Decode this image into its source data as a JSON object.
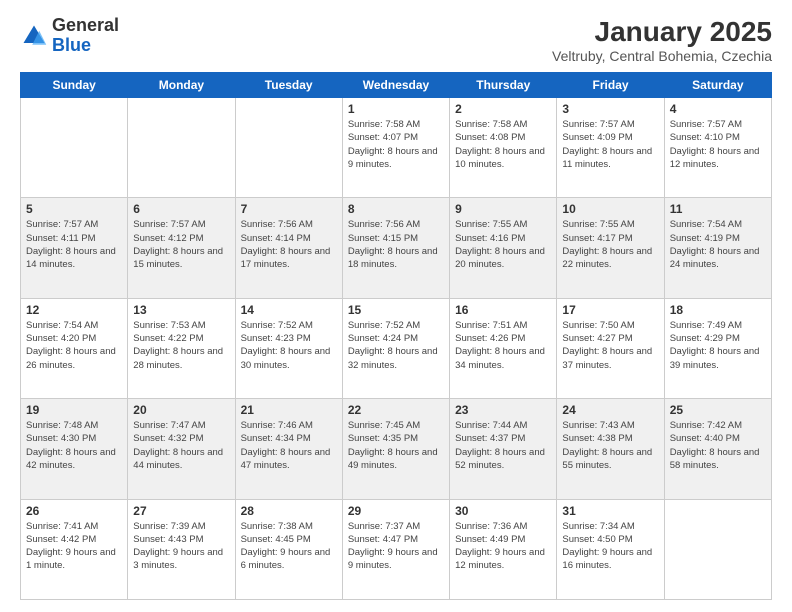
{
  "header": {
    "logo": {
      "general": "General",
      "blue": "Blue"
    },
    "title": "January 2025",
    "subtitle": "Veltruby, Central Bohemia, Czechia"
  },
  "weekdays": [
    "Sunday",
    "Monday",
    "Tuesday",
    "Wednesday",
    "Thursday",
    "Friday",
    "Saturday"
  ],
  "weeks": [
    [
      {
        "day": "",
        "sunrise": "",
        "sunset": "",
        "daylight": ""
      },
      {
        "day": "",
        "sunrise": "",
        "sunset": "",
        "daylight": ""
      },
      {
        "day": "",
        "sunrise": "",
        "sunset": "",
        "daylight": ""
      },
      {
        "day": "1",
        "sunrise": "Sunrise: 7:58 AM",
        "sunset": "Sunset: 4:07 PM",
        "daylight": "Daylight: 8 hours and 9 minutes."
      },
      {
        "day": "2",
        "sunrise": "Sunrise: 7:58 AM",
        "sunset": "Sunset: 4:08 PM",
        "daylight": "Daylight: 8 hours and 10 minutes."
      },
      {
        "day": "3",
        "sunrise": "Sunrise: 7:57 AM",
        "sunset": "Sunset: 4:09 PM",
        "daylight": "Daylight: 8 hours and 11 minutes."
      },
      {
        "day": "4",
        "sunrise": "Sunrise: 7:57 AM",
        "sunset": "Sunset: 4:10 PM",
        "daylight": "Daylight: 8 hours and 12 minutes."
      }
    ],
    [
      {
        "day": "5",
        "sunrise": "Sunrise: 7:57 AM",
        "sunset": "Sunset: 4:11 PM",
        "daylight": "Daylight: 8 hours and 14 minutes."
      },
      {
        "day": "6",
        "sunrise": "Sunrise: 7:57 AM",
        "sunset": "Sunset: 4:12 PM",
        "daylight": "Daylight: 8 hours and 15 minutes."
      },
      {
        "day": "7",
        "sunrise": "Sunrise: 7:56 AM",
        "sunset": "Sunset: 4:14 PM",
        "daylight": "Daylight: 8 hours and 17 minutes."
      },
      {
        "day": "8",
        "sunrise": "Sunrise: 7:56 AM",
        "sunset": "Sunset: 4:15 PM",
        "daylight": "Daylight: 8 hours and 18 minutes."
      },
      {
        "day": "9",
        "sunrise": "Sunrise: 7:55 AM",
        "sunset": "Sunset: 4:16 PM",
        "daylight": "Daylight: 8 hours and 20 minutes."
      },
      {
        "day": "10",
        "sunrise": "Sunrise: 7:55 AM",
        "sunset": "Sunset: 4:17 PM",
        "daylight": "Daylight: 8 hours and 22 minutes."
      },
      {
        "day": "11",
        "sunrise": "Sunrise: 7:54 AM",
        "sunset": "Sunset: 4:19 PM",
        "daylight": "Daylight: 8 hours and 24 minutes."
      }
    ],
    [
      {
        "day": "12",
        "sunrise": "Sunrise: 7:54 AM",
        "sunset": "Sunset: 4:20 PM",
        "daylight": "Daylight: 8 hours and 26 minutes."
      },
      {
        "day": "13",
        "sunrise": "Sunrise: 7:53 AM",
        "sunset": "Sunset: 4:22 PM",
        "daylight": "Daylight: 8 hours and 28 minutes."
      },
      {
        "day": "14",
        "sunrise": "Sunrise: 7:52 AM",
        "sunset": "Sunset: 4:23 PM",
        "daylight": "Daylight: 8 hours and 30 minutes."
      },
      {
        "day": "15",
        "sunrise": "Sunrise: 7:52 AM",
        "sunset": "Sunset: 4:24 PM",
        "daylight": "Daylight: 8 hours and 32 minutes."
      },
      {
        "day": "16",
        "sunrise": "Sunrise: 7:51 AM",
        "sunset": "Sunset: 4:26 PM",
        "daylight": "Daylight: 8 hours and 34 minutes."
      },
      {
        "day": "17",
        "sunrise": "Sunrise: 7:50 AM",
        "sunset": "Sunset: 4:27 PM",
        "daylight": "Daylight: 8 hours and 37 minutes."
      },
      {
        "day": "18",
        "sunrise": "Sunrise: 7:49 AM",
        "sunset": "Sunset: 4:29 PM",
        "daylight": "Daylight: 8 hours and 39 minutes."
      }
    ],
    [
      {
        "day": "19",
        "sunrise": "Sunrise: 7:48 AM",
        "sunset": "Sunset: 4:30 PM",
        "daylight": "Daylight: 8 hours and 42 minutes."
      },
      {
        "day": "20",
        "sunrise": "Sunrise: 7:47 AM",
        "sunset": "Sunset: 4:32 PM",
        "daylight": "Daylight: 8 hours and 44 minutes."
      },
      {
        "day": "21",
        "sunrise": "Sunrise: 7:46 AM",
        "sunset": "Sunset: 4:34 PM",
        "daylight": "Daylight: 8 hours and 47 minutes."
      },
      {
        "day": "22",
        "sunrise": "Sunrise: 7:45 AM",
        "sunset": "Sunset: 4:35 PM",
        "daylight": "Daylight: 8 hours and 49 minutes."
      },
      {
        "day": "23",
        "sunrise": "Sunrise: 7:44 AM",
        "sunset": "Sunset: 4:37 PM",
        "daylight": "Daylight: 8 hours and 52 minutes."
      },
      {
        "day": "24",
        "sunrise": "Sunrise: 7:43 AM",
        "sunset": "Sunset: 4:38 PM",
        "daylight": "Daylight: 8 hours and 55 minutes."
      },
      {
        "day": "25",
        "sunrise": "Sunrise: 7:42 AM",
        "sunset": "Sunset: 4:40 PM",
        "daylight": "Daylight: 8 hours and 58 minutes."
      }
    ],
    [
      {
        "day": "26",
        "sunrise": "Sunrise: 7:41 AM",
        "sunset": "Sunset: 4:42 PM",
        "daylight": "Daylight: 9 hours and 1 minute."
      },
      {
        "day": "27",
        "sunrise": "Sunrise: 7:39 AM",
        "sunset": "Sunset: 4:43 PM",
        "daylight": "Daylight: 9 hours and 3 minutes."
      },
      {
        "day": "28",
        "sunrise": "Sunrise: 7:38 AM",
        "sunset": "Sunset: 4:45 PM",
        "daylight": "Daylight: 9 hours and 6 minutes."
      },
      {
        "day": "29",
        "sunrise": "Sunrise: 7:37 AM",
        "sunset": "Sunset: 4:47 PM",
        "daylight": "Daylight: 9 hours and 9 minutes."
      },
      {
        "day": "30",
        "sunrise": "Sunrise: 7:36 AM",
        "sunset": "Sunset: 4:49 PM",
        "daylight": "Daylight: 9 hours and 12 minutes."
      },
      {
        "day": "31",
        "sunrise": "Sunrise: 7:34 AM",
        "sunset": "Sunset: 4:50 PM",
        "daylight": "Daylight: 9 hours and 16 minutes."
      },
      {
        "day": "",
        "sunrise": "",
        "sunset": "",
        "daylight": ""
      }
    ]
  ]
}
